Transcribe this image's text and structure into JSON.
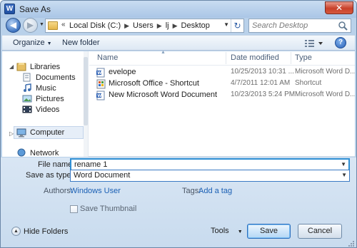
{
  "window": {
    "title": "Save As",
    "app_icon_letter": "W",
    "close_label": "✕"
  },
  "address": {
    "crumbs": [
      "Local Disk (C:)",
      "Users",
      "lj",
      "Desktop"
    ],
    "search_placeholder": "Search Desktop"
  },
  "toolbar": {
    "organize_label": "Organize",
    "new_folder_label": "New folder",
    "help_label": "?"
  },
  "nav": {
    "libraries": "Libraries",
    "documents": "Documents",
    "music": "Music",
    "pictures": "Pictures",
    "videos": "Videos",
    "computer": "Computer",
    "network": "Network"
  },
  "files": {
    "columns": {
      "name": "Name",
      "date": "Date modified",
      "type": "Type"
    },
    "rows": [
      {
        "name": "evelope",
        "date": "10/25/2013 10:31 ...",
        "type": "Microsoft Word D..."
      },
      {
        "name": "Microsoft Office - Shortcut",
        "date": "4/7/2011 12:01 AM",
        "type": "Shortcut"
      },
      {
        "name": "New Microsoft Word Document",
        "date": "10/23/2013 5:24 PM",
        "type": "Microsoft Word D..."
      }
    ]
  },
  "form": {
    "file_name_label": "File name:",
    "file_name_value": "rename 1",
    "save_as_type_label": "Save as type:",
    "save_as_type_value": "Word Document",
    "authors_label": "Authors:",
    "authors_value": "Windows User",
    "tags_label": "Tags:",
    "tags_value": "Add a tag",
    "save_thumbnail_label": "Save Thumbnail",
    "hide_folders_label": "Hide Folders",
    "tools_label": "Tools",
    "save_label": "Save",
    "cancel_label": "Cancel"
  },
  "colors": {
    "accent": "#2d8ed4",
    "link": "#1a5fb4",
    "chrome": "#c8dbee"
  }
}
